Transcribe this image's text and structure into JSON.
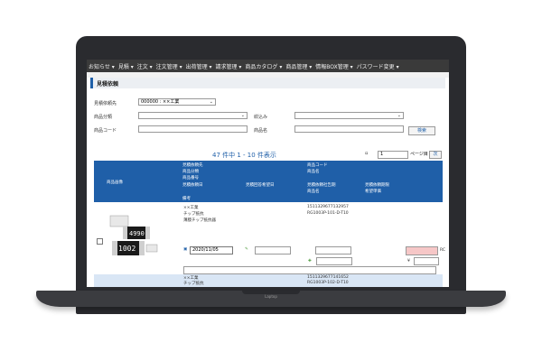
{
  "device": {
    "brand": "Laptop"
  },
  "nav": {
    "items": [
      "お知らせ ▾",
      "見積 ▾",
      "注文 ▾",
      "注文管理 ▾",
      "出荷管理 ▾",
      "請求管理 ▾",
      "商品カタログ ▾",
      "商品管理 ▾",
      "情報BOX管理 ▾",
      "パスワード変更 ▾"
    ]
  },
  "page": {
    "title": "見積依頼"
  },
  "form": {
    "supplier_label": "見積依頼先",
    "supplier_value": "000000 : ××工業",
    "category_label": "商品分類",
    "category_value": "",
    "narrow_label": "絞込み",
    "narrow_value": "",
    "code_label": "商品コード",
    "code_value": "",
    "name_label": "商品名",
    "name_value": "",
    "search_button": "検索"
  },
  "pager": {
    "summary": "47 件中 1 - 10 件表示",
    "page_value": "1",
    "page_suffix": "ページ目",
    "next_button": "次"
  },
  "table": {
    "headers": {
      "image": "商品画像",
      "supplier": "見積依頼先",
      "category": "商品分類",
      "code_no": "商品番号",
      "req_date": "見積依頼日",
      "reply_date": "見積回答希望日",
      "deadline": "見積依頼社告期",
      "due": "見積依頼期限",
      "note": "備考",
      "product_code": "商品コード",
      "product_name": "商品名",
      "product_name2": "商品名",
      "qty": "希望単価"
    },
    "row": {
      "supplier": "××工業",
      "category": "チップ抵抗",
      "desc": "薄膜チップ抵抗器",
      "product_code": "1511329677132957",
      "product_name": "RG1003P-101-D-T10",
      "date": "2020/11/05",
      "unit": "RC",
      "yen": "¥",
      "img_labels": [
        "4990",
        "1002"
      ]
    },
    "row2": {
      "supplier": "××工業",
      "category": "チップ抵抗",
      "product_code": "1511329677141652",
      "product_name": "RG1003P-102-D-T10"
    }
  }
}
